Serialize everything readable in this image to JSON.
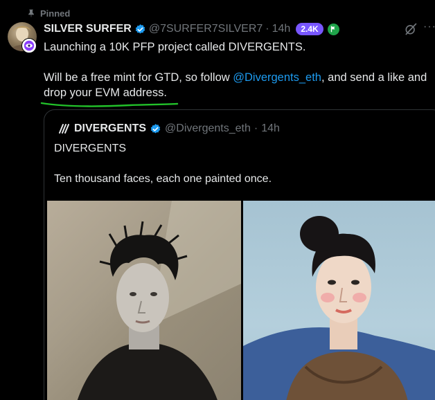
{
  "pinned": {
    "label": "Pinned"
  },
  "author": {
    "name": "SILVER SURFER",
    "handle": "@7SURFER7SILVER7",
    "separator": "·",
    "time": "14h",
    "score_badge": "2.4K",
    "flag_badge_letter": "P"
  },
  "tweet": {
    "line1": "Launching a 10K PFP project called DIVERGENTS.",
    "line2_before": "Will be a free mint for GTD, so follow ",
    "mention": "@Divergents_eth",
    "line2_after": ", and send a like and drop your EVM address."
  },
  "quote": {
    "name": "DIVERGENTS",
    "handle": "@Divergents_eth",
    "separator": "·",
    "time": "14h",
    "text1": "DIVERGENTS",
    "text2": "Ten thousand faces, each one painted once."
  },
  "colors": {
    "accent_link": "#1d9bf0",
    "verified": "#1d9bf0",
    "score_badge": "#7856ff",
    "flag_badge": "#1fa34a",
    "underline_mark": "#22c22a",
    "muted_text": "#71767b"
  },
  "icons": {
    "pin": "pin-icon",
    "verified": "verified-badge-icon",
    "grok": "grok-icon",
    "more": "more-icon",
    "quote_logo": "divergents-logo-icon"
  }
}
